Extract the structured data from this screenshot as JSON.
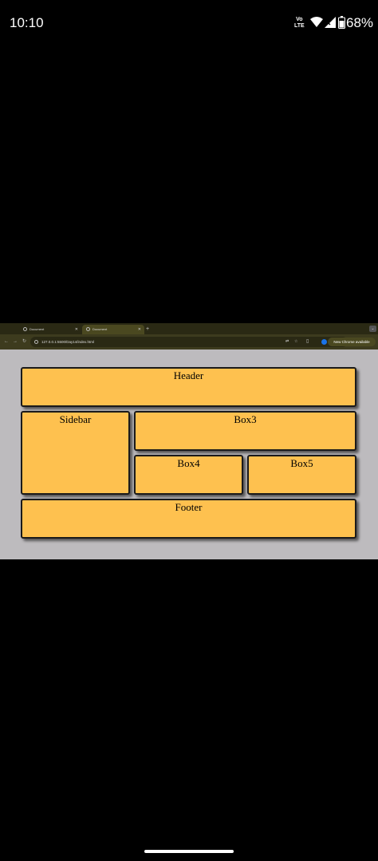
{
  "status_bar": {
    "time": "10:10",
    "volte_top": "Vo",
    "volte_bottom": "LTE",
    "battery": "68%"
  },
  "browser": {
    "tabs": [
      {
        "title": "Document",
        "active": false
      },
      {
        "title": "Document",
        "active": true
      }
    ],
    "new_tab": "+",
    "url": "127.0.0.1:5500/Day14/index.html",
    "update_button": "New Chrome available"
  },
  "page": {
    "header": "Header",
    "sidebar": "Sidebar",
    "box3": "Box3",
    "box4": "Box4",
    "box5": "Box5",
    "footer": "Footer"
  },
  "colors": {
    "box_fill": "#fec14f",
    "page_bg": "#bdbbbe"
  }
}
